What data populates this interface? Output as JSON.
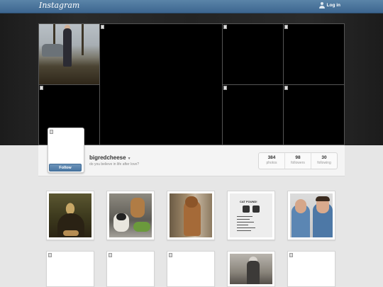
{
  "topbar": {
    "logo": "Instagram",
    "login_label": "Log in"
  },
  "profile": {
    "username": "bigredcheese",
    "bio": "do you believe in life after love?",
    "follow_label": "Follow",
    "stats": [
      {
        "num": "384",
        "label": "photos"
      },
      {
        "num": "98",
        "label": "followers"
      },
      {
        "num": "30",
        "label": "following"
      }
    ]
  },
  "cat_poster_title": "CAT FOUND!",
  "colors": {
    "nav": "#3d6690",
    "button": "#4a77a3",
    "background": "#e6e6e6"
  }
}
